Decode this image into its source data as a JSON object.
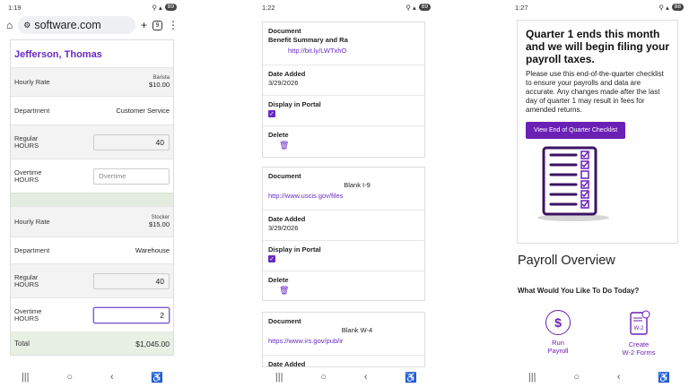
{
  "phone1": {
    "status": {
      "time": "1:19",
      "temp": "92°",
      "battery": "89"
    },
    "url": "software.com",
    "tab_count": "9",
    "employee_name": "Jefferson, Thomas",
    "jobs": [
      {
        "hourly_rate_label": "Hourly Rate",
        "position": "Barista",
        "rate": "$10.00",
        "department_label": "Department",
        "department": "Customer Service",
        "regular_label": "Regular\nHOURS",
        "regular_value": "40",
        "overtime_label": "Overtime\nHOURS",
        "overtime_placeholder": "Overtime"
      },
      {
        "hourly_rate_label": "Hourly Rate",
        "position": "Stocker",
        "rate": "$15.00",
        "department_label": "Department",
        "department": "Warehouse",
        "regular_label": "Regular\nHOURS",
        "regular_value": "40",
        "overtime_label": "Overtime\nHOURS",
        "overtime_value": "2"
      }
    ],
    "total_label": "Total",
    "total_value": "$1,045.00"
  },
  "phone2": {
    "status": {
      "time": "1:22",
      "temp": "92°",
      "battery": "89"
    },
    "documents": [
      {
        "doc_label": "Document",
        "doc_name": "Benefit Summary and Ra",
        "link": "http://bit.ly/LWTxhO",
        "date_label": "Date Added",
        "date": "3/29/2026",
        "display_label": "Display in Portal",
        "delete_label": "Delete"
      },
      {
        "doc_label": "Document",
        "doc_name": "Blank I-9",
        "link": "http://www.uscis.gov/files",
        "date_label": "Date Added",
        "date": "3/29/2026",
        "display_label": "Display in Portal",
        "delete_label": "Delete"
      },
      {
        "doc_label": "Document",
        "doc_name": "Blank W-4",
        "link": "https://www.irs.gov/pub/ir",
        "date_label": "Date Added"
      }
    ]
  },
  "phone3": {
    "status": {
      "time": "1:27",
      "temp": "92°",
      "battery": "88"
    },
    "quarter_title": "Quarter 1 ends this month and we will begin filing your payroll taxes.",
    "quarter_body": "Please use this end-of-the-quarter checklist to ensure your payrolls and data are accurate. Any changes made after the last day of quarter 1 may result in fees for amended returns.",
    "checklist_button": "View End of Quarter Checklist",
    "overview_title": "Payroll Overview",
    "overview_sub": "What Would You Like To Do Today?",
    "actions": [
      {
        "label_1": "Run",
        "label_2": "Payroll",
        "icon": "dollar-icon"
      },
      {
        "label_1": "Create",
        "label_2": "W-2 Forms",
        "icon": "w2-form-icon"
      }
    ]
  },
  "colors": {
    "accent": "#6a2bc3",
    "button": "#6a1fb5",
    "total_bg": "#e8f0e4"
  }
}
